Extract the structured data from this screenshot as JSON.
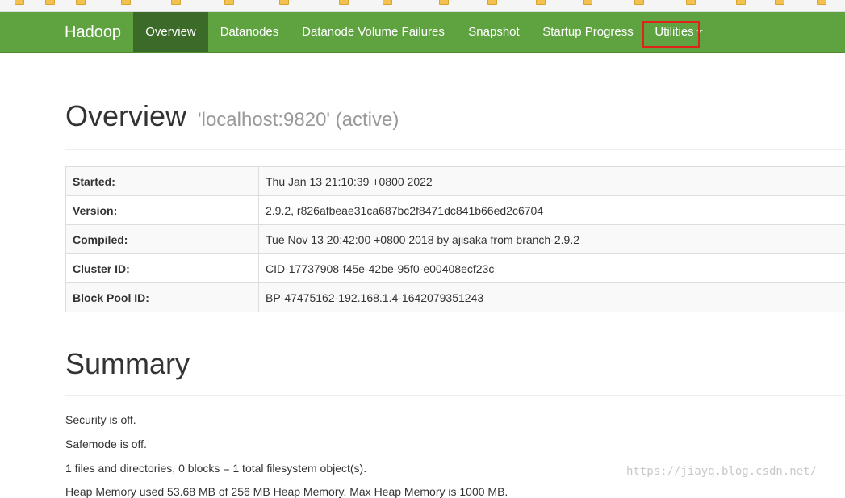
{
  "navbar": {
    "brand": "Hadoop",
    "items": [
      {
        "label": "Overview",
        "active": true
      },
      {
        "label": "Datanodes",
        "active": false
      },
      {
        "label": "Datanode Volume Failures",
        "active": false
      },
      {
        "label": "Snapshot",
        "active": false
      },
      {
        "label": "Startup Progress",
        "active": false
      },
      {
        "label": "Utilities",
        "active": false,
        "dropdown": true
      }
    ],
    "colors": {
      "background": "#5fa341",
      "active": "#3c6a28",
      "highlight_box": "#e0231a"
    }
  },
  "overview": {
    "title": "Overview",
    "subtitle": "'localhost:9820' (active)",
    "rows": [
      {
        "key": "Started:",
        "value": "Thu Jan 13 21:10:39 +0800 2022"
      },
      {
        "key": "Version:",
        "value": "2.9.2, r826afbeae31ca687bc2f8471dc841b66ed2c6704"
      },
      {
        "key": "Compiled:",
        "value": "Tue Nov 13 20:42:00 +0800 2018 by ajisaka from branch-2.9.2"
      },
      {
        "key": "Cluster ID:",
        "value": "CID-17737908-f45e-42be-95f0-e00408ecf23c"
      },
      {
        "key": "Block Pool ID:",
        "value": "BP-47475162-192.168.1.4-1642079351243"
      }
    ]
  },
  "summary": {
    "title": "Summary",
    "lines": [
      "Security is off.",
      "Safemode is off.",
      "1 files and directories, 0 blocks = 1 total filesystem object(s).",
      "Heap Memory used 53.68 MB of 256 MB Heap Memory. Max Heap Memory is 1000 MB."
    ]
  },
  "watermark": "https://jiayq.blog.csdn.net/"
}
